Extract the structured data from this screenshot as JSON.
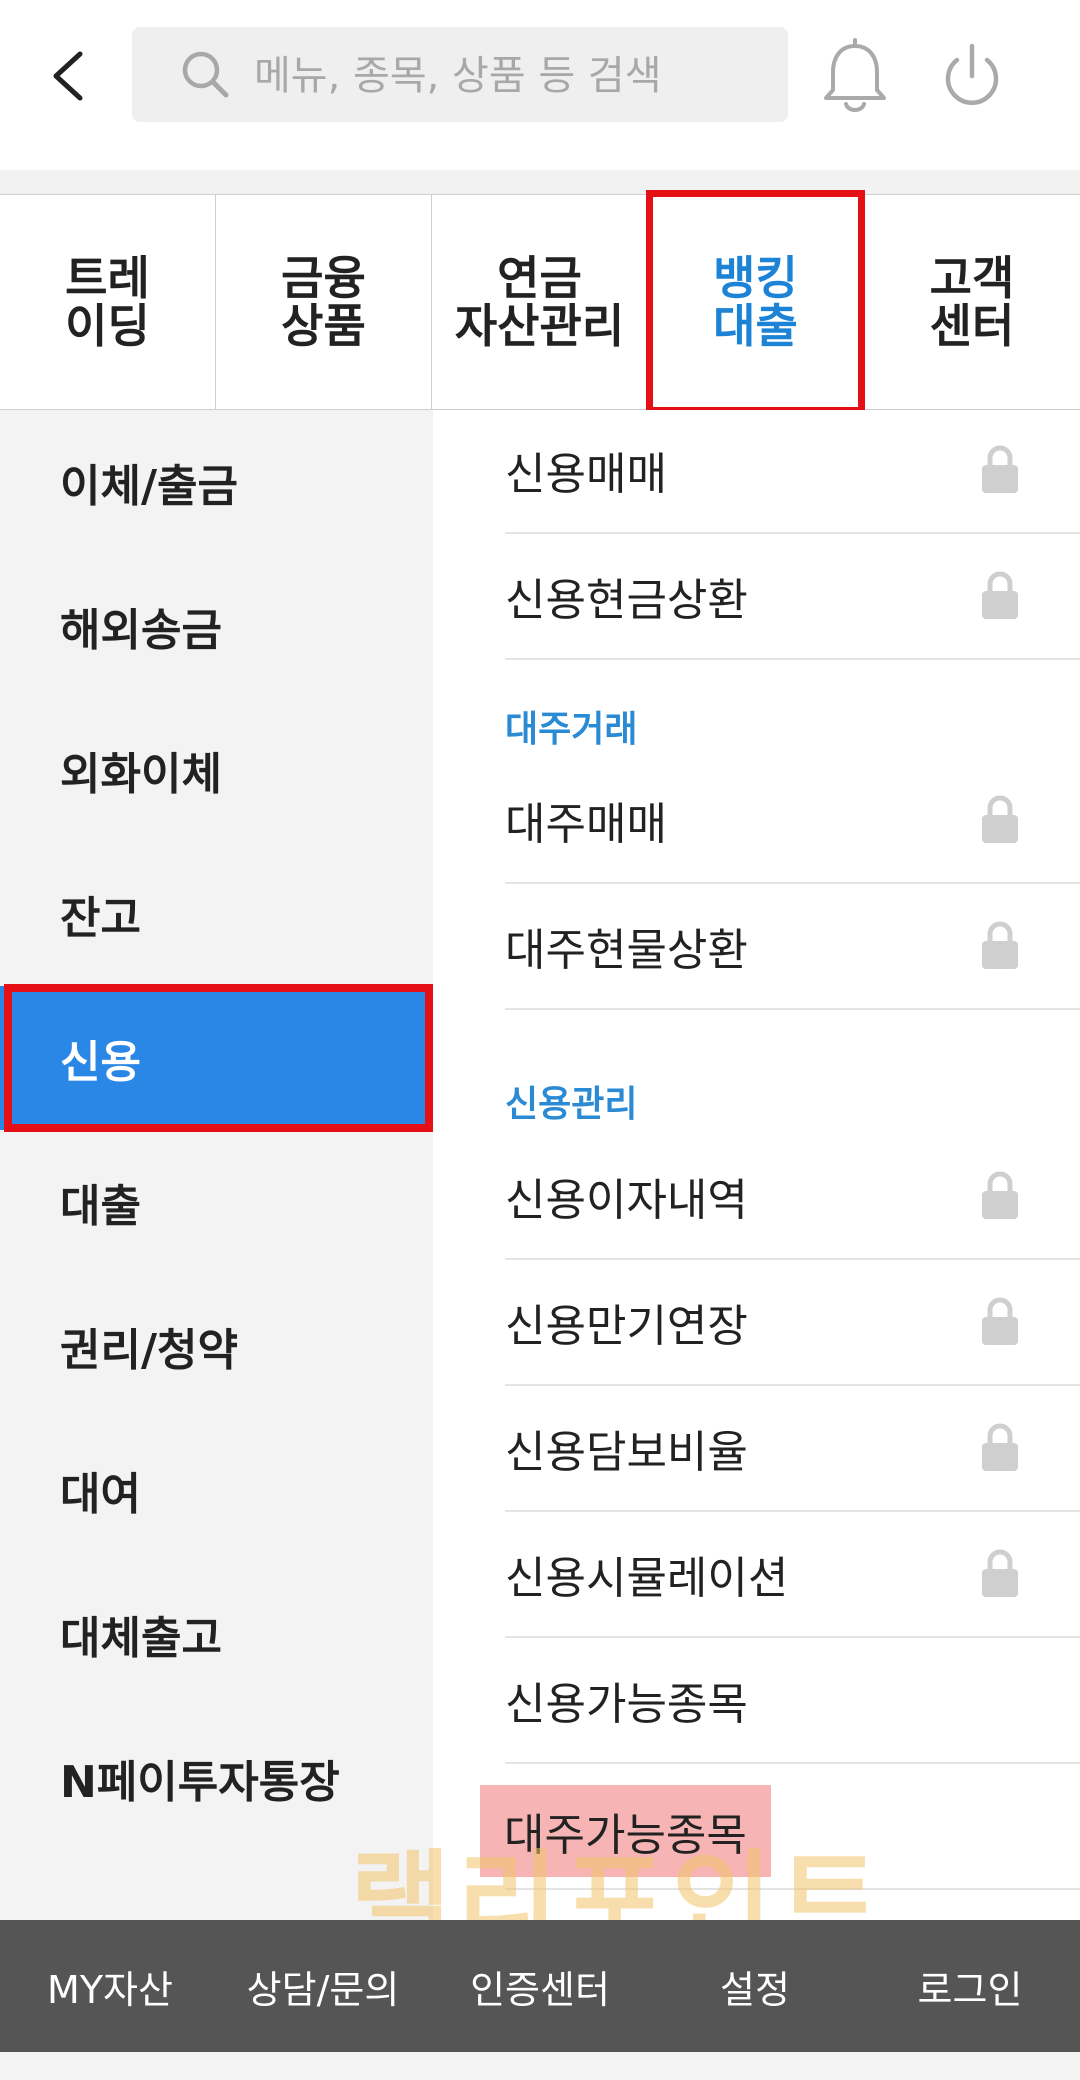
{
  "header": {
    "back_icon": "chevron-left-icon",
    "search_placeholder": "메뉴, 종목, 상품 등 검색",
    "bell_icon": "bell-icon",
    "power_icon": "power-icon"
  },
  "tabs": [
    {
      "label": "트레\n이딩",
      "active": false
    },
    {
      "label": "금융\n상품",
      "active": false
    },
    {
      "label": "연금\n자산관리",
      "active": false
    },
    {
      "label": "뱅킹\n대출",
      "active": true
    },
    {
      "label": "고객\n센터",
      "active": false
    }
  ],
  "sidebar": {
    "items": [
      {
        "label": "이체/출금",
        "active": false
      },
      {
        "label": "해외송금",
        "active": false
      },
      {
        "label": "외화이체",
        "active": false
      },
      {
        "label": "잔고",
        "active": false
      },
      {
        "label": "신용",
        "active": true
      },
      {
        "label": "대출",
        "active": false
      },
      {
        "label": "권리/청약",
        "active": false
      },
      {
        "label": "대여",
        "active": false
      },
      {
        "label": "대체출고",
        "active": false
      },
      {
        "label": "N페이투자통장",
        "active": false
      }
    ]
  },
  "content": {
    "rows_top": [
      {
        "label": "신용매매",
        "locked": true
      },
      {
        "label": "신용현금상환",
        "locked": true
      }
    ],
    "section_daeju": "대주거래",
    "rows_daeju": [
      {
        "label": "대주매매",
        "locked": true
      },
      {
        "label": "대주현물상환",
        "locked": true
      }
    ],
    "section_credit_mgmt": "신용관리",
    "rows_credit_mgmt": [
      {
        "label": "신용이자내역",
        "locked": true
      },
      {
        "label": "신용만기연장",
        "locked": true
      },
      {
        "label": "신용담보비율",
        "locked": true
      },
      {
        "label": "신용시뮬레이션",
        "locked": true
      },
      {
        "label": "신용가능종목",
        "locked": false
      },
      {
        "label": "대주가능종목",
        "locked": false,
        "highlighted": true
      }
    ],
    "lock_icon": "lock-icon"
  },
  "watermark": "랠리포인트",
  "bottom_bar": {
    "items": [
      "MY자산",
      "상담/문의",
      "인증센터",
      "설정",
      "로그인"
    ]
  },
  "colors": {
    "accent_blue": "#2a87e6",
    "active_tab_text": "#1c83d6",
    "section_head": "#2a8ad4",
    "highlight_red": "#e41016",
    "highlight_pink": "#f6b4b4",
    "bottom_bar": "#555555"
  }
}
